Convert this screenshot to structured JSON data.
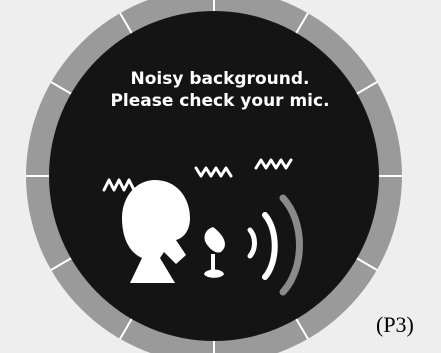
{
  "status_message": {
    "line1": "Noisy background.",
    "line2": "Please check your mic."
  },
  "page_label": "(P3)",
  "icons": {
    "person": "speaking-person-icon",
    "microphone": "microphone-icon",
    "sound_waves": "sound-waves-icon",
    "noise": "noise-squiggle-icon",
    "dial_ring": "level-ring"
  },
  "colors": {
    "page_background": "#eeeeee",
    "ring": "#9a9a9a",
    "ring_ticks": "#ffffff",
    "disc": "#141414",
    "glyph": "#ffffff",
    "outer_wave": "#8a8a8a"
  }
}
